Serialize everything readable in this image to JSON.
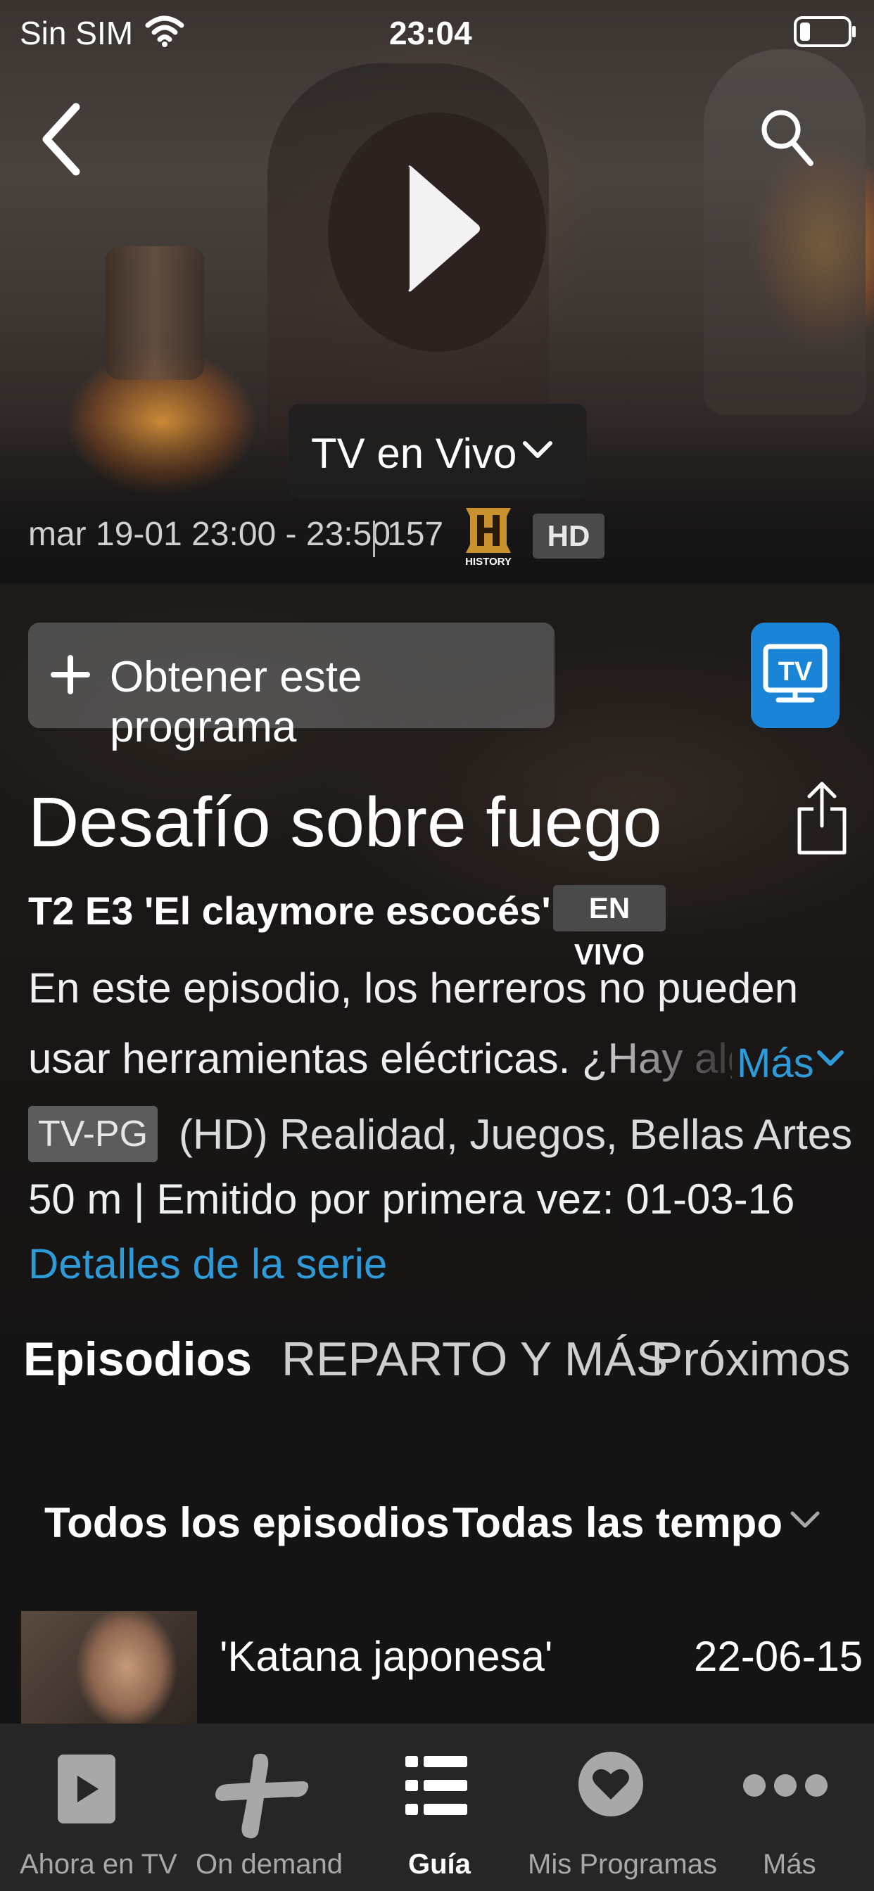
{
  "status_bar": {
    "carrier": "Sin SIM",
    "time": "23:04"
  },
  "hero": {
    "live_dropdown_label": "TV en Vivo",
    "schedule": "mar 19-01 23:00 - 23:50",
    "channel_number": "157",
    "channel_logo_text": "HISTORY",
    "quality_badge": "HD"
  },
  "actions": {
    "get_program_label": "Obtener este programa",
    "tv_app_label": "TV"
  },
  "program": {
    "title": "Desafío sobre fuego",
    "episode": "T2 E3 'El claymore escocés'",
    "live_badge": "EN VIVO",
    "description_line1": "En este episodio, los herreros no pueden",
    "description_line2": "usar herramientas eléctricas. ¿Hay algo",
    "more_label": "Más",
    "rating": "TV-PG",
    "genres": "(HD) Realidad, Juegos, Bellas Artes",
    "air_info": "50 m | Emitido por primera vez: 01-03-16",
    "series_details_label": "Detalles de la serie"
  },
  "tabs": [
    {
      "label": "Episodios"
    },
    {
      "label": "REPARTO Y MÁS"
    },
    {
      "label": "Próximos"
    }
  ],
  "filters": {
    "episodes": "Todos los episodios",
    "seasons": "Todas las tempo"
  },
  "episodes": [
    {
      "title": "'Katana japonesa'",
      "date": "22-06-15"
    }
  ],
  "bottom_nav": [
    {
      "label": "Ahora en TV",
      "icon": "play-square-icon"
    },
    {
      "label": "On demand",
      "icon": "plus-brand-icon"
    },
    {
      "label": "Guía",
      "icon": "list-icon"
    },
    {
      "label": "Mis Programas",
      "icon": "heart-icon"
    },
    {
      "label": "Más",
      "icon": "more-dots-icon"
    }
  ],
  "colors": {
    "accent_blue": "#2e9ad8",
    "tv_button_blue": "#1a85d6",
    "background": "#141414",
    "nav_background": "#262626"
  }
}
